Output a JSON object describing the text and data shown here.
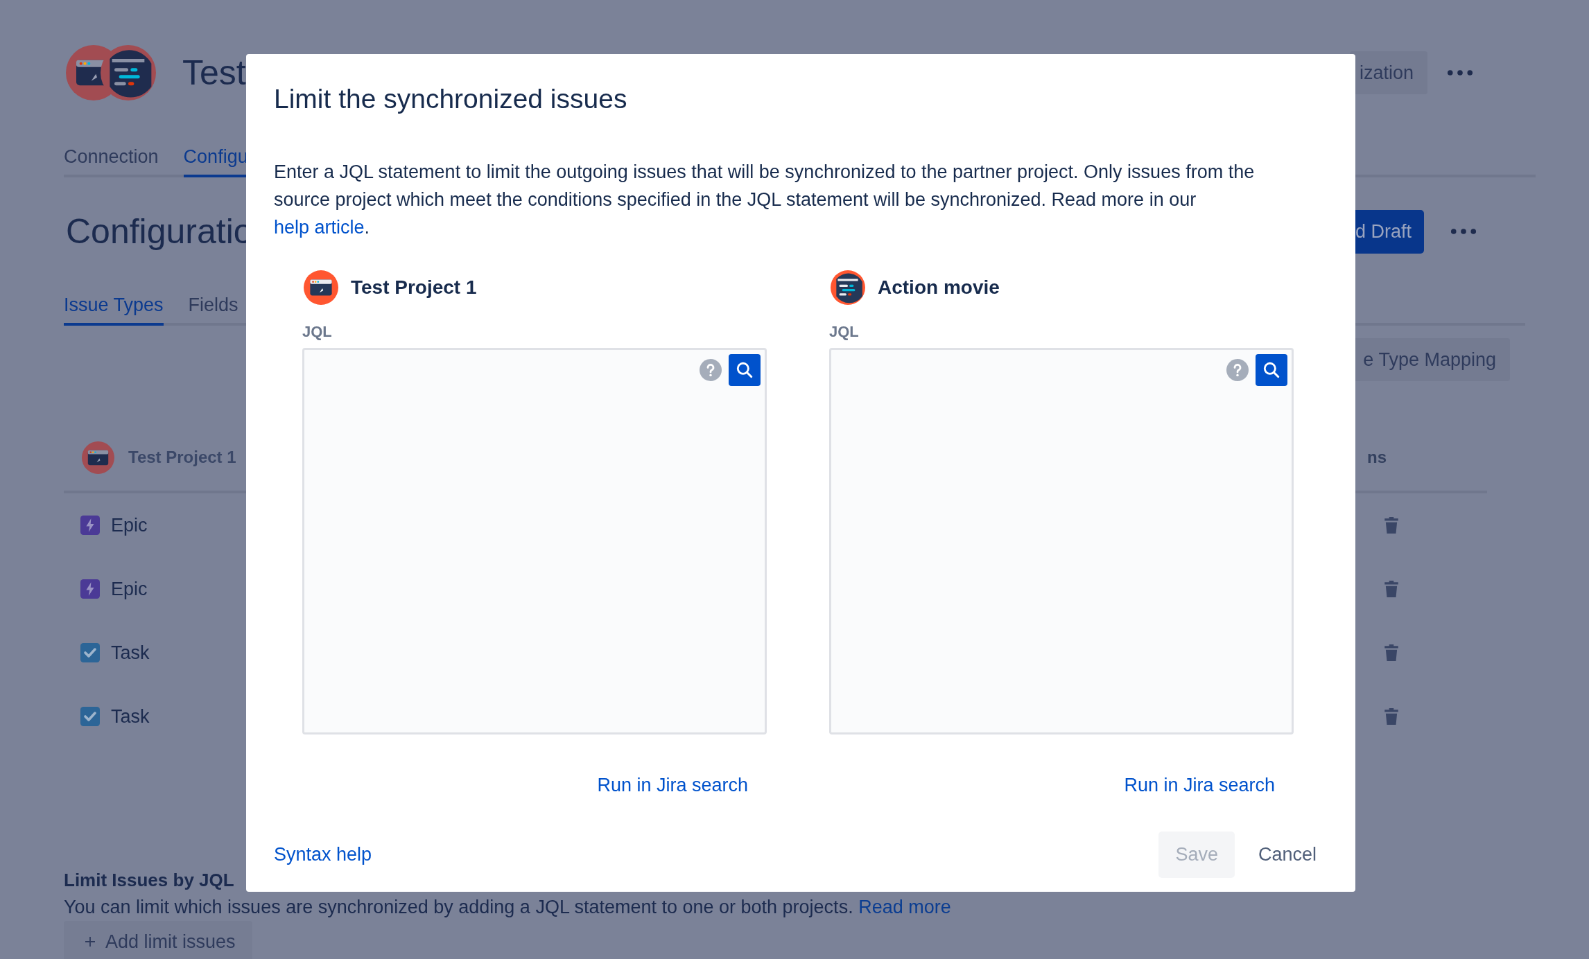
{
  "page": {
    "project_avatars": [
      {
        "kind": "browser"
      },
      {
        "kind": "code"
      }
    ],
    "title": "Test",
    "header_button": "ization",
    "nav_tabs": [
      {
        "label": "Connection",
        "selected": false
      },
      {
        "label": "Configu",
        "selected": true
      }
    ],
    "heading": "Configuratio",
    "publish_button": "d Draft",
    "section_tabs": [
      {
        "label": "Issue Types",
        "selected": true
      },
      {
        "label": "Fields",
        "selected": false
      }
    ],
    "mapping_button": "e Type Mapping",
    "table": {
      "project": {
        "name": "Test Project 1",
        "avatar": {
          "kind": "browser"
        }
      },
      "column_3": "ns",
      "rows": [
        {
          "kind": "epic",
          "label": "Epic"
        },
        {
          "kind": "epic",
          "label": "Epic"
        },
        {
          "kind": "task",
          "label": "Task"
        },
        {
          "kind": "task",
          "label": "Task"
        }
      ]
    },
    "limit_section": {
      "title": "Limit Issues by JQL",
      "text": "You can limit which issues are synchronized by adding a JQL statement to one or both projects.",
      "link": "Read more",
      "button": "Add limit issues"
    }
  },
  "dialog": {
    "title": "Limit the synchronized issues",
    "description": "Enter a JQL statement to limit the outgoing issues that will be synchronized to the partner project. Only issues from the source project which meet the conditions specified in the JQL statement will be synchronized. Read more in our",
    "description_link": "help article",
    "description_end": ".",
    "projects": [
      {
        "name": "Test Project 1",
        "avatar": {
          "kind": "browser"
        },
        "jql_label": "JQL",
        "run_link": "Run in Jira search"
      },
      {
        "name": "Action movie",
        "avatar": {
          "kind": "code"
        },
        "jql_label": "JQL",
        "run_link": "Run in Jira search"
      }
    ],
    "syntax_link": "Syntax help",
    "save": {
      "label": "Save",
      "disabled": true
    },
    "cancel": "Cancel"
  }
}
